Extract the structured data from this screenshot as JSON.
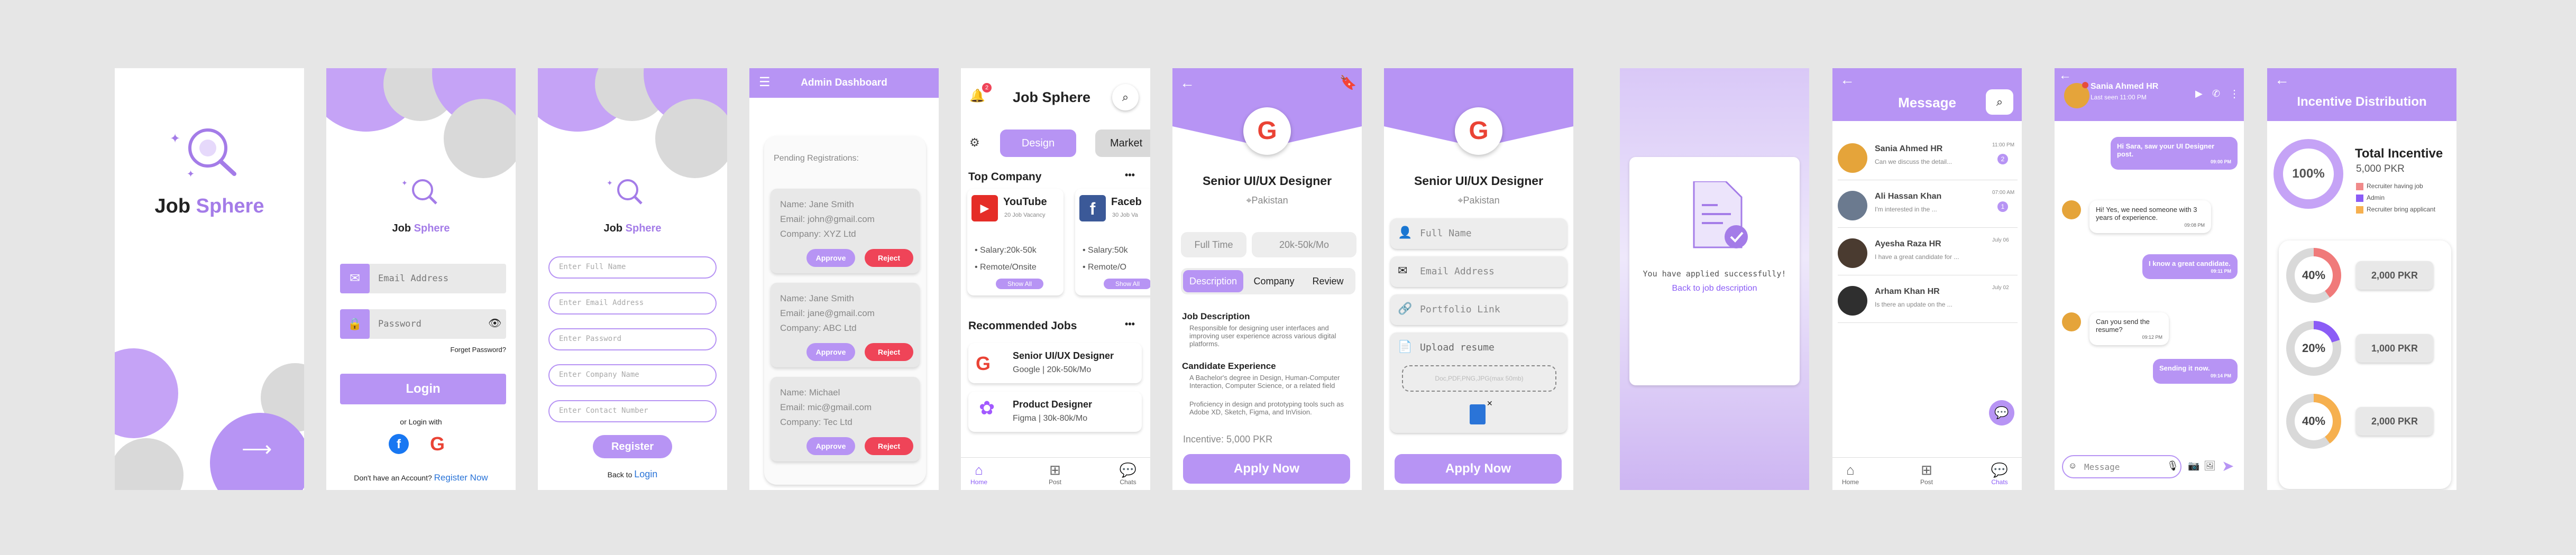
{
  "brand": {
    "job": "Job",
    "sphere": "Sphere"
  },
  "login": {
    "email_placeholder": "Email Address",
    "password_placeholder": "Password",
    "forgot": "Forget Password?",
    "login_btn": "Login",
    "or_login": "or Login with",
    "no_account": "Don't have an Account?",
    "register_now": "Register Now"
  },
  "register": {
    "fields": [
      "Enter Full Name",
      "Enter Email Address",
      "Enter Password",
      "Enter Company Name",
      "Enter Contact Number"
    ],
    "register_btn": "Register",
    "back_to": "Back to",
    "login_link": "Login"
  },
  "admin": {
    "title": "Admin Dashboard",
    "pending": "Pending Registrations:",
    "labels": {
      "name": "Name:",
      "email": "Email:",
      "company": "Company:"
    },
    "approve": "Approve",
    "reject": "Reject",
    "items": [
      {
        "name": "Jane Smith",
        "email": "john@gmail.com",
        "company": "XYZ Ltd"
      },
      {
        "name": "Jane Smith",
        "email": "jane@gmail.com",
        "company": "ABC Ltd"
      },
      {
        "name": "Michael",
        "email": "mic@gmail.com",
        "company": "Tec Ltd"
      }
    ]
  },
  "home": {
    "badge": "2",
    "filters": [
      "Design",
      "Market"
    ],
    "top_company": "Top Company",
    "more": "•••",
    "companies": [
      {
        "name": "YouTube",
        "sub": "20 Job Vacancy",
        "salary": "Salary:20k-50k",
        "mode": "Remote/Onsite",
        "show": "Show All"
      },
      {
        "name": "Faceb",
        "sub": "30 Job Va",
        "salary": "Salary:50k",
        "mode": "Remote/O",
        "show": "Show All"
      }
    ],
    "recommended": "Recommended Jobs",
    "jobs": [
      {
        "title": "Senior UI/UX Designer",
        "company": "Google",
        "salary": "20k-50k/Mo"
      },
      {
        "title": "Product Designer",
        "company": "Figma",
        "salary": "30k-80k/Mo"
      }
    ],
    "nav": [
      "Home",
      "Post",
      "Chats"
    ]
  },
  "job_detail": {
    "title": "Senior UI/UX Designer",
    "location": "Pakistan",
    "type": "Full Time",
    "salary": "20k-50k/Mo",
    "tabs": [
      "Description",
      "Company",
      "Review"
    ],
    "desc_h": "Job Description",
    "desc_items": [
      "Responsible for designing user interfaces and improving user experience across various digital platforms."
    ],
    "cand_h": "Candidate Experience",
    "cand_items": [
      "A Bachelor's degree in Design, Human-Computer Interaction, Computer Science, or a related field",
      "Proficiency in design and prototyping tools such as Adobe XD, Sketch, Figma, and InVision."
    ],
    "incentive": "Incentive: 5,000 PKR",
    "apply": "Apply Now"
  },
  "apply_form": {
    "title": "Senior UI/UX Designer",
    "location": "Pakistan",
    "fields": [
      "Full Name",
      "Email Address",
      "Portfolio Link"
    ],
    "upload": "Upload resume",
    "upload_hint": "Doc,PDF,PNG,JPG(max 50mb)",
    "apply": "Apply Now"
  },
  "success": {
    "msg": "You have applied successfully!",
    "back": "Back to job description"
  },
  "messages": {
    "title": "Message",
    "items": [
      {
        "name": "Sania Ahmed HR",
        "time": "11:00 PM",
        "preview": "Can we discuss the detail...",
        "count": "2"
      },
      {
        "name": "Ali Hassan Khan",
        "time": "07:00 AM",
        "preview": "I'm interested in the ...",
        "count": "1"
      },
      {
        "name": "Ayesha Raza HR",
        "time": "July 06",
        "preview": "I have a great candidate for ...",
        "count": ""
      },
      {
        "name": "Arham Khan HR",
        "time": "July 02",
        "preview": "Is there an update on the ...",
        "count": ""
      }
    ],
    "nav": [
      "Home",
      "Post",
      "Chats"
    ]
  },
  "chat": {
    "name": "Sania Ahmed HR",
    "status": "Last seen 11:00 PM",
    "placeholder": "Message",
    "msgs": [
      {
        "side": "r",
        "text": "Hi Sara, saw your UI Designer post.",
        "time": "09:00 PM"
      },
      {
        "side": "l",
        "text": "Hi! Yes, we need someone with 3 years of experience.",
        "time": "09:08 PM"
      },
      {
        "side": "r",
        "text": "I know a great candidate.",
        "time": "09:11 PM"
      },
      {
        "side": "l",
        "text": "Can you send the resume?",
        "time": "09:12 PM"
      },
      {
        "side": "r",
        "text": "Sending it now.",
        "time": "09:14 PM"
      }
    ]
  },
  "incentive": {
    "title": "Incentive Distribution",
    "total_label": "Total Incentive",
    "total": "5,000 PKR",
    "pct": "100%",
    "legend": [
      {
        "label": "Recruiter having job",
        "color": "#f08a8a"
      },
      {
        "label": "Admin",
        "color": "#8b5cf6"
      },
      {
        "label": "Recruiter bring applicant",
        "color": "#f6b04f"
      }
    ],
    "rows": [
      {
        "pct": "40%",
        "fraction": 0.4,
        "color": "#f07a7a",
        "amount": "2,000 PKR"
      },
      {
        "pct": "20%",
        "fraction": 0.2,
        "color": "#8b5cf6",
        "amount": "1,000 PKR"
      },
      {
        "pct": "40%",
        "fraction": 0.4,
        "color": "#f6b04f",
        "amount": "2,000 PKR"
      }
    ]
  },
  "colors": {
    "accent": "#b794f4",
    "reject": "#ef4458",
    "blue": "#2a74d8"
  }
}
